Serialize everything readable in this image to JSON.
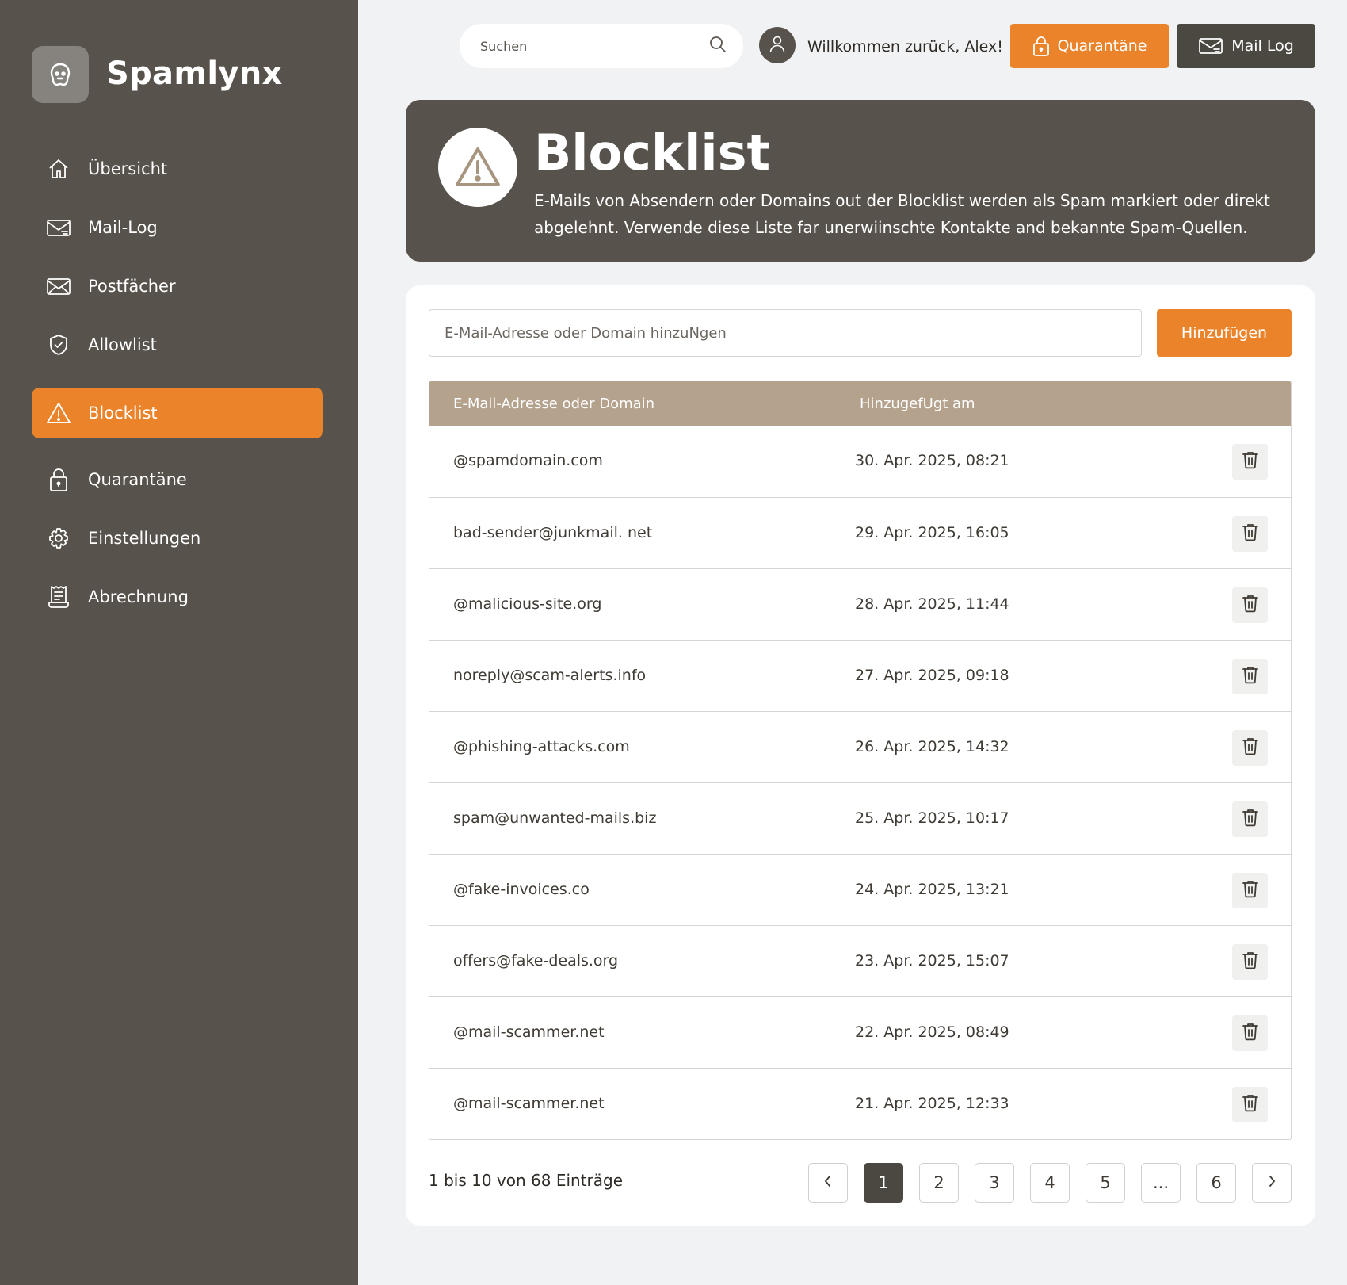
{
  "app": {
    "name": "Spamlynx"
  },
  "sidebar": {
    "items": [
      {
        "label": "Übersicht",
        "icon": "home-icon"
      },
      {
        "label": "Mail-Log",
        "icon": "mail-log-icon"
      },
      {
        "label": "Postfächer",
        "icon": "envelope-icon"
      },
      {
        "label": "Allowlist",
        "icon": "shield-check-icon"
      },
      {
        "label": "Blocklist",
        "icon": "warning-icon",
        "active": true
      },
      {
        "label": "Quarantäne",
        "icon": "lock-icon"
      },
      {
        "label": "Einstellungen",
        "icon": "gear-icon"
      },
      {
        "label": "Abrechnung",
        "icon": "receipt-icon"
      }
    ]
  },
  "topbar": {
    "search_placeholder": "Suchen",
    "welcome": "Willkommen zurück, Alex!",
    "quarantine_label": "Quarantäne",
    "maillog_label": "Mail Log"
  },
  "header": {
    "title": "Blocklist",
    "description": "E-Mails von Absendern oder Domains out der Blocklist werden als Spam markiert oder direkt abgelehnt. Verwende diese Liste far unerwiinschte Kontakte and bekannte Spam-Quellen."
  },
  "form": {
    "placeholder": "E-Mail-Adresse oder Domain hinzuNgen",
    "add_label": "Hinzufügen"
  },
  "table": {
    "headers": [
      "E-Mail-Adresse oder Domain",
      "HinzugefUgt am"
    ],
    "rows": [
      {
        "entry": "@spamdomain.com",
        "date": "30. Apr. 2025, 08:21"
      },
      {
        "entry": "bad-sender@junkmail. net",
        "date": "29. Apr. 2025, 16:05"
      },
      {
        "entry": "@malicious-site.org",
        "date": "28. Apr. 2025, 11:44"
      },
      {
        "entry": "noreply@scam-alerts.info",
        "date": "27. Apr. 2025, 09:18"
      },
      {
        "entry": "@phishing-attacks.com",
        "date": "26. Apr. 2025, 14:32"
      },
      {
        "entry": "spam@unwanted-mails.biz",
        "date": "25. Apr. 2025, 10:17"
      },
      {
        "entry": "@fake-invoices.co",
        "date": "24. Apr. 2025, 13:21"
      },
      {
        "entry": "offers@fake-deals.org",
        "date": "23. Apr. 2025, 15:07"
      },
      {
        "entry": "@mail-scammer.net",
        "date": "22. Apr. 2025, 08:49"
      },
      {
        "entry": "@mail-scammer.net",
        "date": "21. Apr. 2025, 12:33"
      }
    ]
  },
  "pagination": {
    "summary": "1 bis 10 von 68 Einträge",
    "pages": [
      "1",
      "2",
      "3",
      "4",
      "5",
      "...",
      "6"
    ],
    "current": "1"
  },
  "colors": {
    "sidebar": "#57524B",
    "accent": "#EB832A",
    "table_header": "#B5A28C",
    "background": "#F1F2F4"
  }
}
